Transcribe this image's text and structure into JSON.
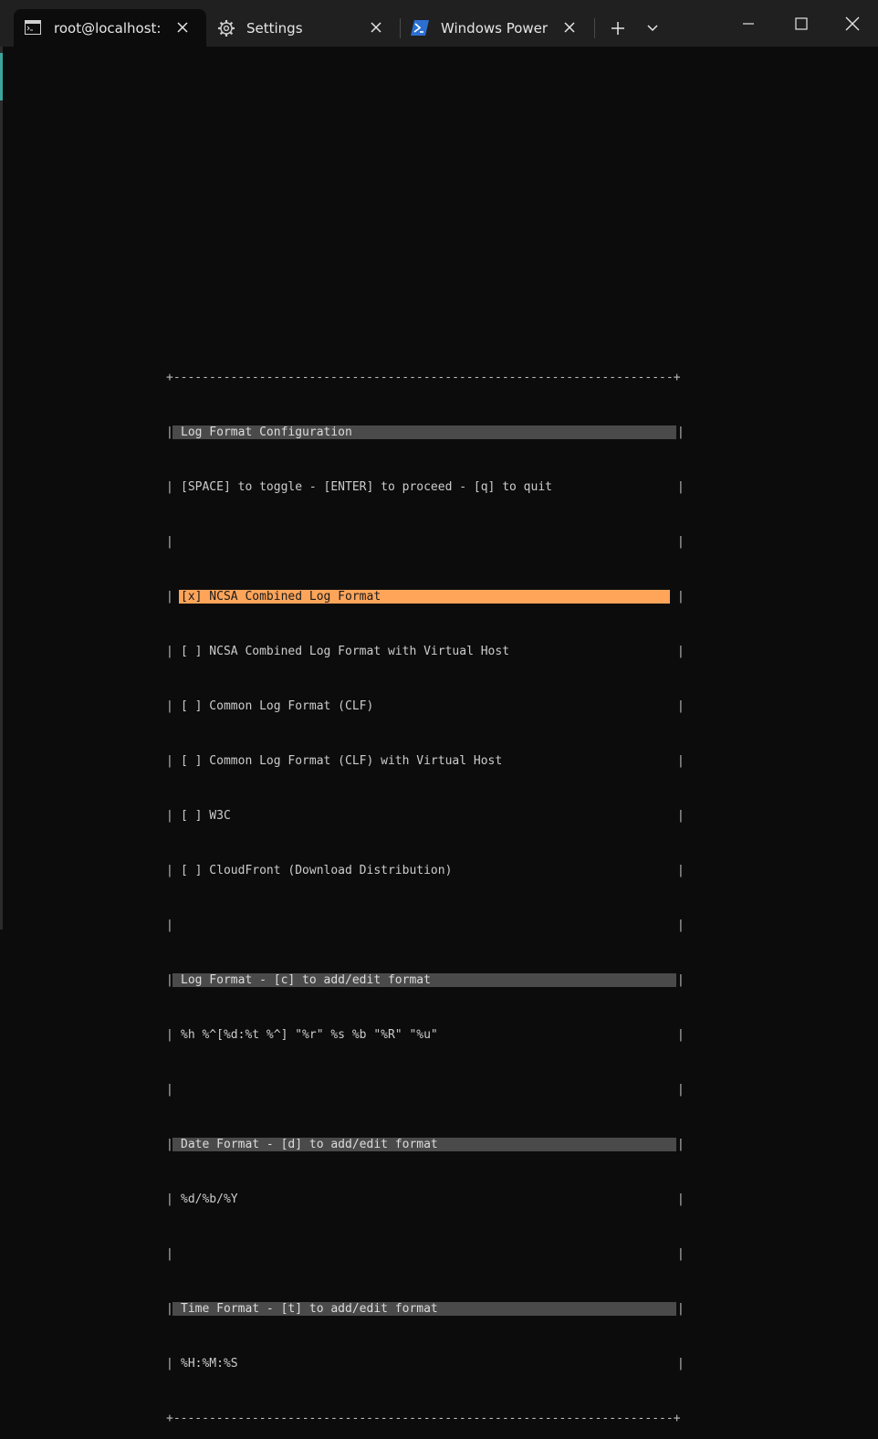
{
  "tabs": [
    {
      "label": "root@localhost:~",
      "icon": "terminal-icon",
      "active": true
    },
    {
      "label": "Settings",
      "icon": "gear-icon",
      "active": false
    },
    {
      "label": "Windows PowerS",
      "icon": "powershell-icon",
      "active": false
    }
  ],
  "window_controls": [
    "new-tab-icon",
    "dropdown-icon",
    "minimize-icon",
    "maximize-icon",
    "close-icon"
  ],
  "colors": {
    "selection": "#ffa55a",
    "header_bg": "#4a4a4a",
    "terminal_bg": "#0c0c0c"
  },
  "terminal": {
    "border_top": "+----------------------------------------------------------------------+",
    "border_bottom": "+----------------------------------------------------------------------+",
    "title": "Log Format Configuration",
    "instructions": "[SPACE] to toggle - [ENTER] to proceed - [q] to quit",
    "options": [
      "[x] NCSA Combined Log Format",
      "[ ] NCSA Combined Log Format with Virtual Host",
      "[ ] Common Log Format (CLF)",
      "[ ] Common Log Format (CLF) with Virtual Host",
      "[ ] W3C",
      "[ ] CloudFront (Download Distribution)"
    ],
    "log_format_header": "Log Format - [c] to add/edit format",
    "log_format_value": "%h %^[%d:%t %^] \"%r\" %s %b \"%R\" \"%u\"",
    "date_format_header": "Date Format - [d] to add/edit format",
    "date_format_value": "%d/%b/%Y",
    "time_format_header": "Time Format - [t] to add/edit format",
    "time_format_value": "%H:%M:%S"
  }
}
